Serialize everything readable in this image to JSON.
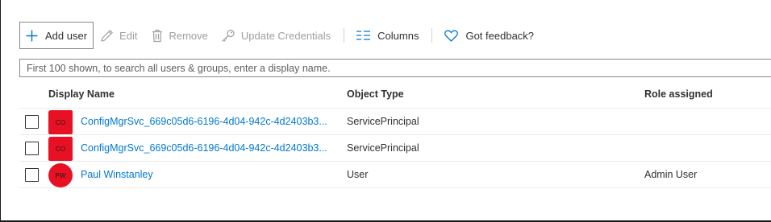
{
  "toolbar": {
    "add_user": "Add user",
    "edit": "Edit",
    "remove": "Remove",
    "update_credentials": "Update Credentials",
    "columns": "Columns",
    "feedback": "Got feedback?"
  },
  "search": {
    "placeholder": "First 100 shown, to search all users & groups, enter a display name."
  },
  "table": {
    "columns": [
      "Display Name",
      "Object Type",
      "Role assigned"
    ],
    "rows": [
      {
        "initials": "CO",
        "name": "ConfigMgrSvc_669c05d6-6196-4d04-942c-4d2403b3...",
        "type": "ServicePrincipal",
        "role": ""
      },
      {
        "initials": "CO",
        "name": "ConfigMgrSvc_669c05d6-6196-4d04-942c-4d2403b3...",
        "type": "ServicePrincipal",
        "role": ""
      },
      {
        "initials": "PW",
        "name": "Paul Winstanley",
        "type": "User",
        "role": "Admin User"
      }
    ]
  },
  "colors": {
    "accent": "#0078d4",
    "avatar": "#e81123",
    "disabled": "#a19f9d"
  },
  "icons": [
    "plus-icon",
    "edit-icon",
    "trash-icon",
    "key-icon",
    "columns-icon",
    "heart-icon"
  ]
}
